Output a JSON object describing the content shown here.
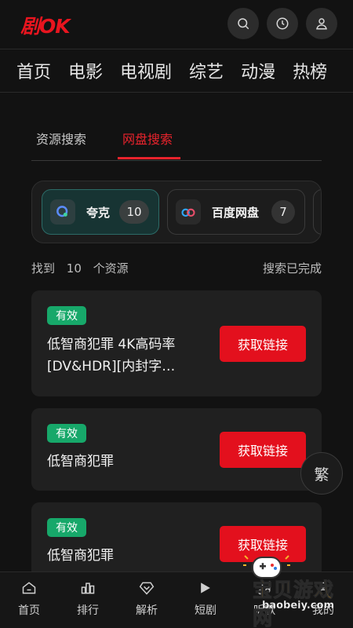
{
  "app": {
    "logo": "剧OK"
  },
  "header": {
    "icons": [
      "search-icon",
      "history-icon",
      "user-icon"
    ]
  },
  "nav": {
    "items": [
      "首页",
      "电影",
      "电视剧",
      "综艺",
      "动漫",
      "热榜"
    ]
  },
  "tabs": {
    "items": [
      "资源搜索",
      "网盘搜索"
    ],
    "active_index": 1
  },
  "providers": [
    {
      "name": "夸克",
      "count": "10",
      "icon": "quark-icon",
      "active": true
    },
    {
      "name": "百度网盘",
      "count": "7",
      "icon": "baidu-pan-icon",
      "active": false
    }
  ],
  "summary": {
    "prefix": "找到",
    "count": "10",
    "suffix": "个资源",
    "status": "搜索已完成"
  },
  "results": [
    {
      "badge": "有效",
      "title": "低智商犯罪  4K高码率[DV&HDR][内封字…",
      "button": "获取链接"
    },
    {
      "badge": "有效",
      "title": "低智商犯罪",
      "button": "获取链接"
    },
    {
      "badge": "有效",
      "title": "低智商犯罪",
      "button": "获取链接"
    }
  ],
  "float_button": {
    "label": "繁"
  },
  "bottom_nav": {
    "items": [
      {
        "label": "首页",
        "icon": "home-icon"
      },
      {
        "label": "排行",
        "icon": "ranking-icon"
      },
      {
        "label": "解析",
        "icon": "diamond-icon"
      },
      {
        "label": "短剧",
        "icon": "short-drama-icon"
      },
      {
        "label": "听歌",
        "icon": "music-icon"
      },
      {
        "label": "我的",
        "icon": "profile-icon"
      }
    ]
  },
  "watermark": {
    "title": "宝贝游戏网",
    "url": "baobeiy.com"
  },
  "colors": {
    "accent": "#e3101d",
    "valid": "#17a86a",
    "background": "#121212"
  }
}
